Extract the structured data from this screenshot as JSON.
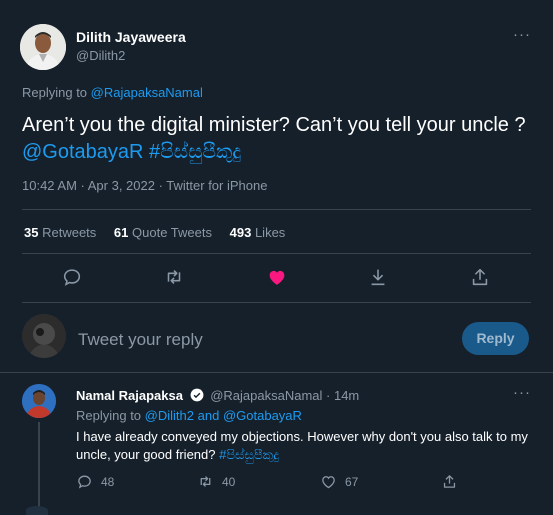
{
  "tweet": {
    "author_name": "Dilith Jayaweera",
    "author_handle": "@Dilith2",
    "replying_prefix": "Replying to",
    "replying_to": "@RajapaksaNamal",
    "text_plain": "Aren’t you the digital minister? Can’t you tell your uncle ? ",
    "mention": "@GotabayaR",
    "hashtag": "#පිස්සුපීකුදු",
    "meta": "10:42 AM · Apr 3, 2022 · Twitter for iPhone",
    "more": "···"
  },
  "stats": {
    "retweets_count": "35",
    "retweets_label": "Retweets",
    "quotes_count": "61",
    "quotes_label": "Quote Tweets",
    "likes_count": "493",
    "likes_label": "Likes"
  },
  "composer": {
    "placeholder": "Tweet your reply",
    "reply_button": "Reply"
  },
  "reply": {
    "author_name": "Namal Rajapaksa",
    "author_handle": "@RajapaksaNamal",
    "time": "· 14m",
    "replying_prefix": "Replying to",
    "replying_to_1": "@Dilith2",
    "replying_and": "and",
    "replying_to_2": "@GotabayaR",
    "text_plain": "I have already conveyed my objections. However why don't you also talk to my uncle, your good friend? ",
    "hashtag": "#පිස්සුපීකුදු",
    "replies": "48",
    "retweets": "40",
    "likes": "67",
    "more": "···"
  },
  "colors": {
    "background": "#15202b",
    "accent": "#1d9bf0",
    "like_active": "#f91880",
    "muted": "#8b98a5"
  },
  "icons": [
    "reply-icon",
    "retweet-icon",
    "like-icon",
    "share-icon",
    "verified-icon",
    "more-icon"
  ]
}
